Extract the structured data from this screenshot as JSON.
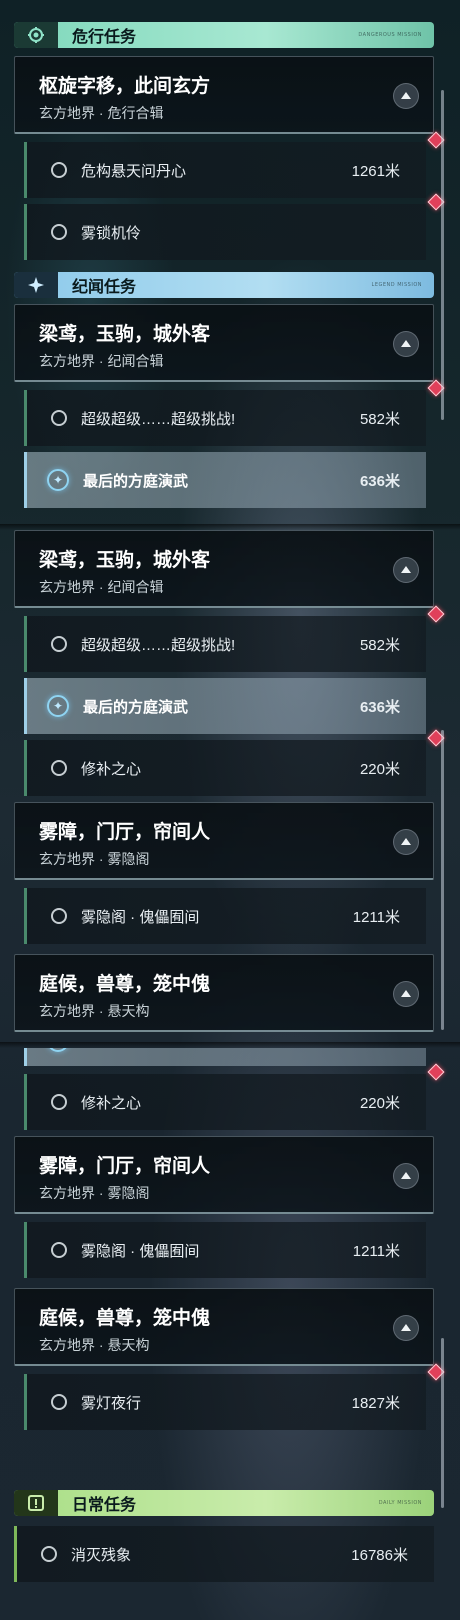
{
  "categories": {
    "dangerous": {
      "label": "危行任务",
      "tiny": "DANGEROUS MISSION",
      "color": "#8fe3c8"
    },
    "legend": {
      "label": "纪闻任务",
      "tiny": "LEGEND MISSION",
      "color": "#9fd3ee"
    },
    "daily": {
      "label": "日常任务",
      "tiny": "DAILY MISSION",
      "color": "#b7e58f"
    }
  },
  "quests": {
    "q1": {
      "title": "枢旋字移，此间玄方",
      "sub": "玄方地界 · 危行合辑"
    },
    "q2": {
      "title": "梁鸢，玉驹，城外客",
      "sub": "玄方地界 · 纪闻合辑"
    },
    "q3": {
      "title": "雾障，门厅，帘间人",
      "sub": "玄方地界 · 雾隐阁"
    },
    "q4": {
      "title": "庭候，兽尊，笼中傀",
      "sub": "玄方地界 · 悬天构"
    }
  },
  "tasks": {
    "t1": {
      "label": "危构悬天问丹心",
      "dist": "1261米"
    },
    "t2": {
      "label": "雾锁机伶",
      "dist": ""
    },
    "t3": {
      "label": "超级超级……超级挑战!",
      "dist": "582米"
    },
    "t4": {
      "label": "最后的方庭演武",
      "dist": "636米"
    },
    "t5": {
      "label": "修补之心",
      "dist": "220米"
    },
    "t6": {
      "label": "雾隐阁 · 傀儡囿间",
      "dist": "1211米"
    },
    "t7": {
      "label": "雾灯夜行",
      "dist": "1827米"
    },
    "t8": {
      "label": "消灭残象",
      "dist": "16786米"
    }
  },
  "icons": {
    "dangerous": "gear-eye-icon",
    "legend": "four-point-star-icon",
    "daily": "exclamation-icon",
    "collapse": "chevron-up-icon",
    "track": "compass-icon",
    "flag": "diamond-marker-icon"
  }
}
